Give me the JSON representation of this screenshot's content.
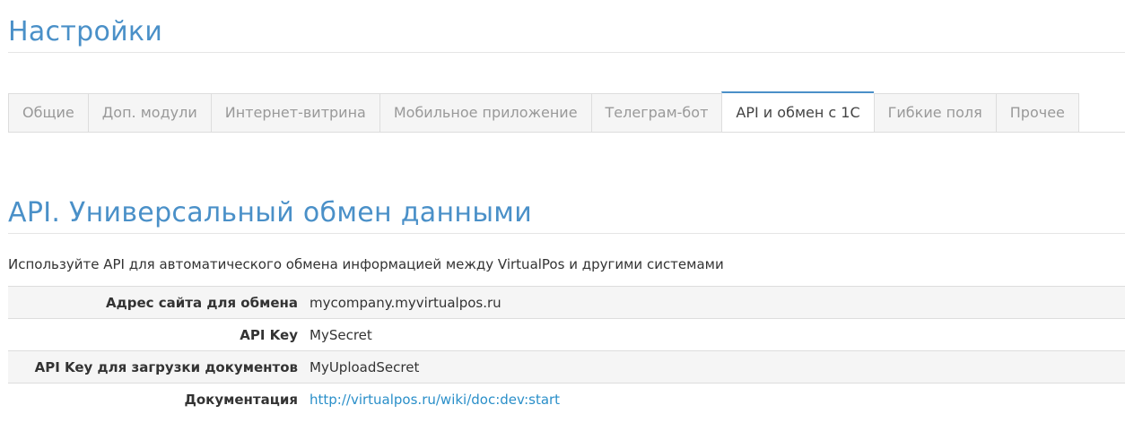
{
  "header": {
    "title": "Настройки"
  },
  "tabs": [
    {
      "label": "Общие",
      "active": false
    },
    {
      "label": "Доп. модули",
      "active": false
    },
    {
      "label": "Интернет-витрина",
      "active": false
    },
    {
      "label": "Мобильное приложение",
      "active": false
    },
    {
      "label": "Телеграм-бот",
      "active": false
    },
    {
      "label": "API и обмен с 1С",
      "active": true
    },
    {
      "label": "Гибкие поля",
      "active": false
    },
    {
      "label": "Прочее",
      "active": false
    }
  ],
  "section": {
    "title": "API. Универсальный обмен данными",
    "description": "Используйте API для автоматического обмена информацией между VirtualPos и другими системами"
  },
  "settings": [
    {
      "label": "Адрес сайта для обмена",
      "value": "mycompany.myvirtualpos.ru"
    },
    {
      "label": "API Key",
      "value": "MySecret"
    },
    {
      "label": "API Key для загрузки документов",
      "value": "MyUploadSecret"
    },
    {
      "label": "Документация",
      "value": "http://virtualpos.ru/wiki/doc:dev:start"
    }
  ],
  "colors": {
    "accent": "#4a90c8",
    "link": "#2a8fc9",
    "border": "#dddddd",
    "stripe": "#f5f5f5"
  }
}
